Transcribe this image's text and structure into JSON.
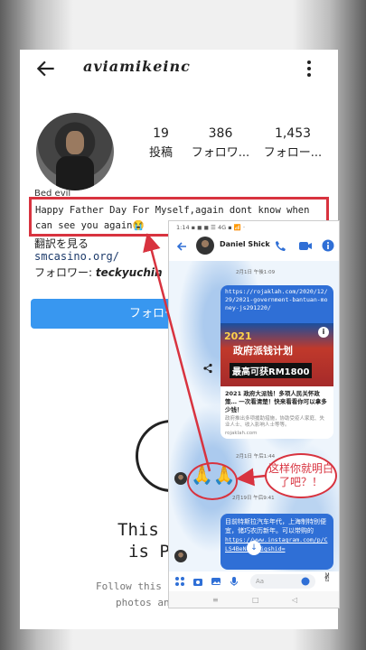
{
  "profile": {
    "username": "aviamikeinc",
    "stats": [
      {
        "value": "19",
        "label": "投稿"
      },
      {
        "value": "386",
        "label": "フォロワ..."
      },
      {
        "value": "1,453",
        "label": "フォロー..."
      }
    ],
    "bio_name": "Bed evil",
    "bio_text": "Happy Father Day For Myself,again dont know when can see you again😭",
    "translate_link": "翻訳を見る",
    "website": "smcasino.org/",
    "followers_label": "フォロワー:",
    "followers_name": "teckyuchin",
    "follow_button": "フォロー",
    "private_title": "This A",
    "private_title2": "is P",
    "private_sub1": "Follow this ac",
    "private_sub2": "photos and videos."
  },
  "messenger": {
    "status_time": "1:14 ▪ ◼ ◼ ☰ 4G ▪ 📶 ⋅",
    "contact_name": "Daniel Shick",
    "time1": "2月1日 午後1:09",
    "link_url": "https://rojaklah.com/2020/12/29/2021-government-bantuan-money-js291220/",
    "link_year": "2021",
    "link_headline": "政府派钱计划",
    "link_sub": "最高可获RM1800",
    "link_desc": "2021 政府大派钱！多项人民关怀政策… 一次看清楚！快来看看你可以拿多少钱！",
    "link_small": "政府推出多项援助措施，协助受疫人家庭、失业人士、收入影响人士等等。",
    "link_domain": "rojaklah.com",
    "time2": "2月1日 午后1:44",
    "pray": "🙏🙏",
    "time3": "2月19日 午后9:41",
    "text_bubble": "目前特斯拉汽车年代，上海制特别便宜，储巧农历新年。可以带购的",
    "text_link": "https://www.instagram.com/p/CLS4BeNuY/?igshid=",
    "input_placeholder": "Aa",
    "emoji": "✌"
  },
  "annotation": {
    "text": "这样你就明白了吧？！"
  },
  "colors": {
    "accent_red": "#d8333f",
    "messenger_blue": "#2f6fd6",
    "follow_blue": "#3897f0"
  }
}
